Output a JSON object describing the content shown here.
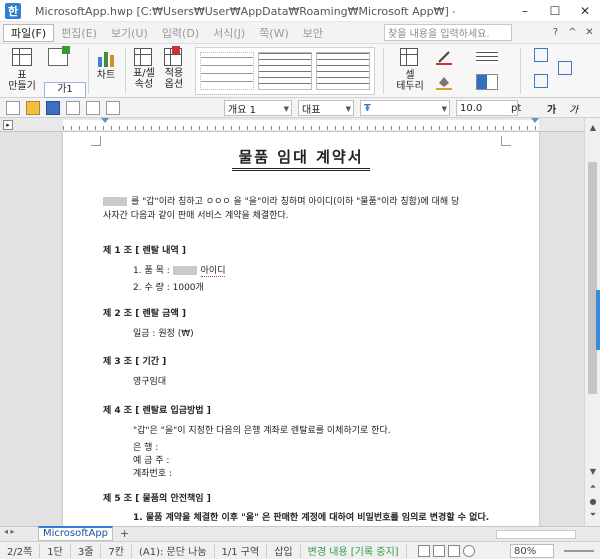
{
  "window": {
    "app_icon": "한",
    "title": "MicrosoftApp.hwp [C:₩Users₩User₩AppData₩Roaming₩Microsoft App₩] - 한컴오피스 한글",
    "minimize": "–",
    "maximize": "☐",
    "close": "✕"
  },
  "menu": {
    "items": [
      "파일(F)",
      "편집(E)",
      "보기(U)",
      "입력(D)",
      "서식(J)",
      "쪽(W)",
      "보안"
    ],
    "search_placeholder": "찾을 내용을 입력하세요.",
    "right_icons": [
      "?",
      "^",
      "✕"
    ]
  },
  "ribbon": {
    "table_make": "표\n만들기",
    "style_label": "가1",
    "chart": "차트",
    "table_cell_props": "표/셀\n속성",
    "apply_options": "적용\n옵션",
    "cell_border": "셀\n테두리"
  },
  "toolbar2": {
    "style_value": "개요 1",
    "font_lang": "대표",
    "font_name": "",
    "font_size": "10.0",
    "font_unit": "pt",
    "bold": "가",
    "italic": "가"
  },
  "document": {
    "title": "물품 임대 계약서",
    "intro_line1": "를 \"갑\"이라 칭하고  ㅇㅇㅇ 을 \"을\"이라 칭하며  아이디(이하 \"물품\"이라 칭함)에 대해 당",
    "intro_line2": "사자간 다음과 같이 판매 서비스 계약을 체결한다.",
    "art1_title": "제 1 조 [ 렌탈 내역 ]",
    "art1_item1": "1. 품    목 :",
    "art1_item1_value": "아이디",
    "art1_item2": "2. 수    량 : 1000개",
    "art2_title": "제 2 조 [ 렌탈 금액 ]",
    "art2_body": "일금 :   원정 (₩)",
    "art3_title": "제 3 조 [ 기간 ]",
    "art3_body": "영구임대",
    "art4_title": "제 4 조 [ 렌탈료 입금방법 ]",
    "art4_body": "\"갑\"은 \"을\"이 지정한 다음의 은행 계좌로 렌탈료를 이체하기로 한다.",
    "art4_bank": "은    행 :",
    "art4_holder": "예 금 주 :",
    "art4_account": "계좌번호 :",
    "art5_title": "제 5 조 [ 물품의 안전책임 ]",
    "art5_body": "1. 물품 계약을 체결한 이후 \"을\" 은 판매한 계정에 대하여 비밀번호를 임의로 변경할 수 없다."
  },
  "tabs": {
    "active": "MicrosoftApp",
    "add": "+"
  },
  "status": {
    "page": "2/2쪽",
    "section": "1단",
    "line": "3줄",
    "col": "7칸",
    "para": "(A1): 문단 나눔",
    "area": "1/1 구역",
    "insert": "삽입",
    "track": "변경 내용 [기록 중지]",
    "zoom": "80%"
  }
}
